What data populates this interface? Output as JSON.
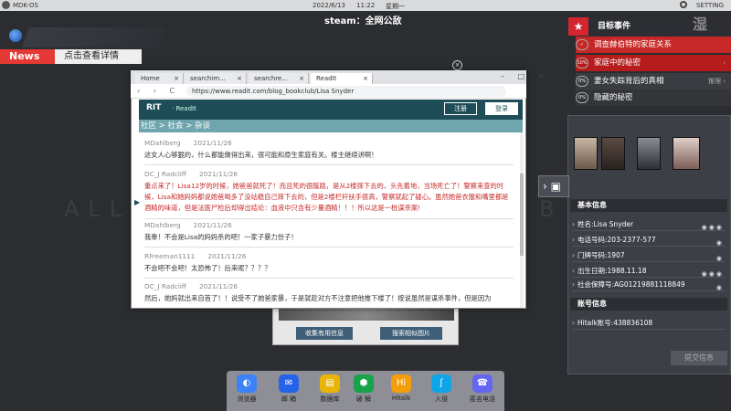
{
  "topbar": {
    "os_name": "MDK-OS",
    "date": "2022/6/13",
    "time": "11:22",
    "weekday": "星期一",
    "setting": "SETTING"
  },
  "desktop": {
    "steam_banner": "steam：全网公敌",
    "bg_left": "ALL",
    "bg_right": "B"
  },
  "news": {
    "tag": "News",
    "text": "点击查看详情"
  },
  "objectives": {
    "header": "目标事件",
    "brand": "湿\n湿",
    "items": [
      {
        "badge": "✓",
        "label": "调查赫伯特的家庭关系",
        "extra": ""
      },
      {
        "badge": "10%",
        "label": "家庭中的秘密",
        "extra": "›"
      },
      {
        "badge": "0%",
        "label": "妻女失踪背后的真相",
        "extra": "推理 ›"
      },
      {
        "badge": "0%",
        "label": "隐藏的秘密",
        "extra": ""
      }
    ]
  },
  "side_panel": {
    "tab_icon": "›",
    "basic_header": "基本信息",
    "rows": [
      {
        "label": "姓名:Lisa Snyder",
        "icons": "◉◉◉"
      },
      {
        "label": "电话号码:203-2377-577",
        "icons": "◉"
      },
      {
        "label": "门牌号码:1907",
        "icons": "◉"
      },
      {
        "label": "出生日期:1988.11.18",
        "icons": "◉◉◉"
      },
      {
        "label": "社会保障号:AG01219881118849",
        "icons": "◉"
      }
    ],
    "account_header": "账号信息",
    "account_rows": [
      {
        "label": "Hitalk账号:438836108"
      }
    ],
    "submit": "提交信息",
    "portrait_colors": [
      "#8a7a6a",
      "#5a4a44",
      "#6a6d73",
      "#b9a7a0"
    ]
  },
  "browser": {
    "tabs": [
      {
        "label": "Home"
      },
      {
        "label": "searchim..."
      },
      {
        "label": "searchre..."
      },
      {
        "label": "ReadIt"
      }
    ],
    "close_x": "×",
    "window_controls": "– □ ×",
    "nav": "‹ › C",
    "url": "https://www.readit.com/blog_bookclub/Lisa Snyder",
    "site": {
      "logo": "RIT",
      "logo_sub": "· ReadIt",
      "register": "注册",
      "login": "登录",
      "breadcrumb": "社区 > 社会 > 杂谈"
    },
    "posts": [
      {
        "user": "MDahlberg",
        "date": "2021/11/26",
        "body": "这女人心够狠的，什么都能做得出来，很可能和原生家庭有关。楼主继续讲啊！",
        "red": false
      },
      {
        "user": "DC_J Radcliff",
        "date": "2021/11/26",
        "body": "重点来了！Lisa12岁的时候，她爸爸就死了！而且死的很蹊跷，是从2楼摔下去的，头先着地，当场死亡了！警察来查的时候，Lisa和她妈妈都说她爸喝多了没站稳自己摔下去的，但是2楼栏杆扶手很高，警察就起了疑心。虽然她爸衣服和嘴里都是酒精的味道，但是法医尸检后却得出结论：血液中只含有少量酒精！！！所以这是一桩谋杀案!",
        "red": true
      },
      {
        "user": "MDahlberg",
        "date": "2021/11/26",
        "body": "我靠！不会是Lisa的妈妈杀的吧！一家子暴力份子！",
        "red": false
      },
      {
        "user": "RFreeman1111",
        "date": "2021/11/26",
        "body": "不会吧不会吧！太恐怖了！后来呢？？？？",
        "red": false
      },
      {
        "user": "DC_J Radcliff",
        "date": "2021/11/26",
        "body": "然后，她妈就出来自首了！！说受不了她爸家暴，于是就趁对方不注意把他推下楼了！按说虽然是谋杀事件，但是因为",
        "red": false
      }
    ]
  },
  "viewer": {
    "collect": "收集有用信息",
    "search": "搜索相似图片"
  },
  "dock": [
    {
      "label": "浏览器",
      "icon": "◐",
      "color": "#3b82f6"
    },
    {
      "label": "邮 箱",
      "icon": "✉",
      "color": "#2563eb"
    },
    {
      "label": "数据库",
      "icon": "▤",
      "color": "#eab308"
    },
    {
      "label": "破 解",
      "icon": "⬢",
      "color": "#16a34a"
    },
    {
      "label": "Hitalk",
      "icon": "Hi",
      "color": "#f59e0b"
    },
    {
      "label": "入侵",
      "icon": "ʃ",
      "color": "#0ea5e9"
    },
    {
      "label": "匿名电话",
      "icon": "☎",
      "color": "#6366f1"
    }
  ]
}
